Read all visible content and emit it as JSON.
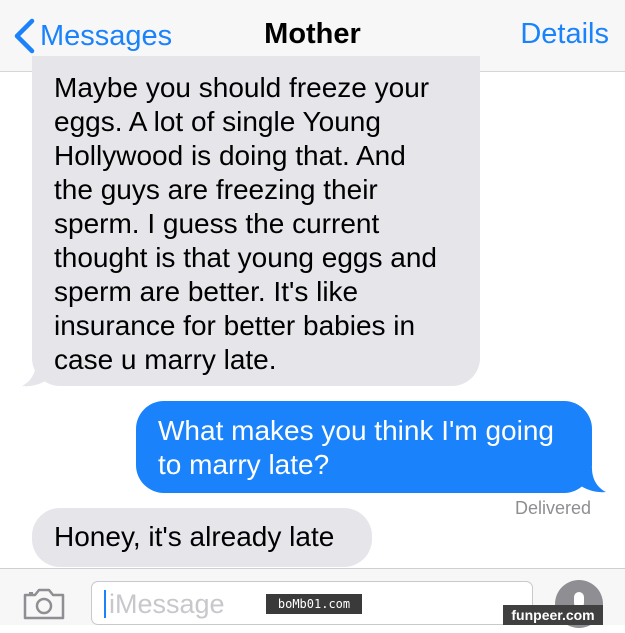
{
  "navbar": {
    "back_label": "Messages",
    "title": "Mother",
    "details_label": "Details"
  },
  "messages": [
    {
      "sender": "contact",
      "lines": [
        "Maybe you should freeze your",
        "eggs. A lot of single Young",
        "Hollywood is doing that. And",
        "the guys are freezing their",
        "sperm. I guess the current",
        "thought is that young eggs and",
        "sperm are better. It's like",
        "insurance for better babies in",
        "case u marry late."
      ]
    },
    {
      "sender": "me",
      "lines": [
        "What makes you think I'm going",
        "to marry late?"
      ],
      "status": "Delivered"
    },
    {
      "sender": "contact",
      "lines": [
        "Honey, it's already late"
      ]
    }
  ],
  "composer": {
    "placeholder": "iMessage"
  },
  "watermarks": {
    "center": "boMb01.com",
    "corner": "funpeer.com"
  },
  "colors": {
    "accent": "#1a82fb",
    "incoming_bubble": "#e5e5ea",
    "outgoing_bubble": "#1a82fb"
  },
  "icons": {
    "back": "chevron-left-icon",
    "camera": "camera-icon",
    "mic": "microphone-icon"
  }
}
